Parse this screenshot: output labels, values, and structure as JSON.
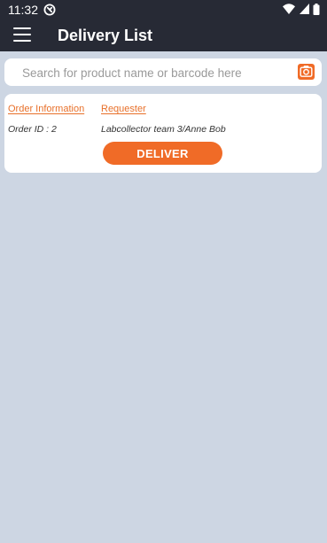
{
  "status_bar": {
    "time": "11:32",
    "icons": [
      "app-notification-icon",
      "wifi-icon",
      "cell-signal-icon",
      "battery-icon"
    ]
  },
  "app_bar": {
    "title": "Delivery List",
    "menu_icon": "hamburger-menu-icon"
  },
  "search": {
    "placeholder": "Search for product name or barcode here",
    "value": "",
    "camera_icon": "camera-icon"
  },
  "order_card": {
    "order_header": "Order Information",
    "requester_header": "Requester",
    "order_id": "Order ID : 2",
    "requester": "Labcollector team 3/Anne Bob",
    "deliver_label": "DELIVER"
  },
  "colors": {
    "header_bg": "#272a35",
    "accent": "#f06b27",
    "page_bg": "#cdd6e3",
    "card_bg": "#ffffff"
  }
}
